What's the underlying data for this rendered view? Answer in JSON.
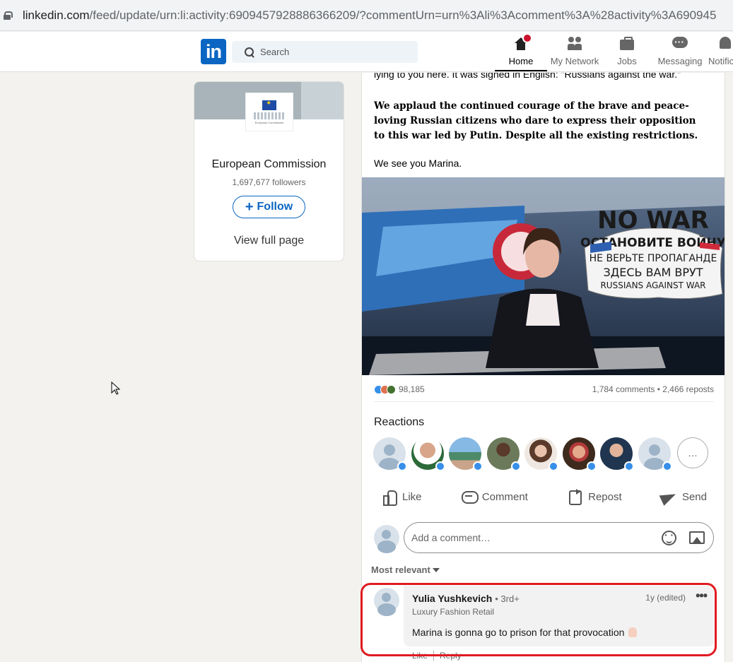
{
  "browser": {
    "url_main": "linkedin.com",
    "url_rest": "/feed/update/urn:li:activity:6909457928886366209/?commentUrn=urn%3Ali%3Acomment%3A%28activity%3A690945"
  },
  "nav": {
    "logo": "in",
    "search_placeholder": "Search",
    "items": [
      {
        "label": "Home",
        "icon": "home-icon",
        "active": true,
        "badge": true
      },
      {
        "label": "My Network",
        "icon": "people-icon"
      },
      {
        "label": "Jobs",
        "icon": "briefcase-icon"
      },
      {
        "label": "Messaging",
        "icon": "chat-icon"
      },
      {
        "label": "Notifications",
        "icon": "bell-icon"
      }
    ]
  },
  "org_card": {
    "logo_text": "European Commission",
    "name": "European Commission",
    "followers": "1,697,677 followers",
    "follow_label": "Follow",
    "view_page_label": "View full page"
  },
  "post": {
    "text_cut": "lying to you here.  It was signed in English: \"Russians against the war.\"",
    "text_bold": "We applaud the continued courage of the brave and peace-loving Russian citizens who dare to express their opposition to this war led by Putin. Despite all the existing restrictions.",
    "text_see": "We see you Marina.",
    "photo": {
      "sign_lines": [
        "NO WAR",
        "ОСТАНОВИТЕ ВОЙНУ",
        "НЕ ВЕРЬТЕ ПРОПАГАНДЕ",
        "ЗДЕСЬ ВАМ ВРУТ",
        "RUSSIANS AGAINST WAR"
      ]
    },
    "reaction_count": "98,185",
    "comments_reposts": "1,784 comments • 2,466 reposts",
    "reactions_title": "Reactions",
    "more_label": "…",
    "actions": {
      "like": "Like",
      "comment": "Comment",
      "repost": "Repost",
      "send": "Send"
    },
    "comment_placeholder": "Add a comment…",
    "sort_label": "Most relevant"
  },
  "comment": {
    "author": "Yulia Yushkevich",
    "degree": "• 3rd+",
    "headline": "Luxury Fashion Retail",
    "time": "1y (edited)",
    "more": "•••",
    "text": "Marina is gonna go to prison for that provocation",
    "like_label": "Like",
    "reply_label": "Reply"
  },
  "colors": {
    "brand": "#0a66c2",
    "highlight": "#e01b22",
    "notification": "#cb112d"
  }
}
